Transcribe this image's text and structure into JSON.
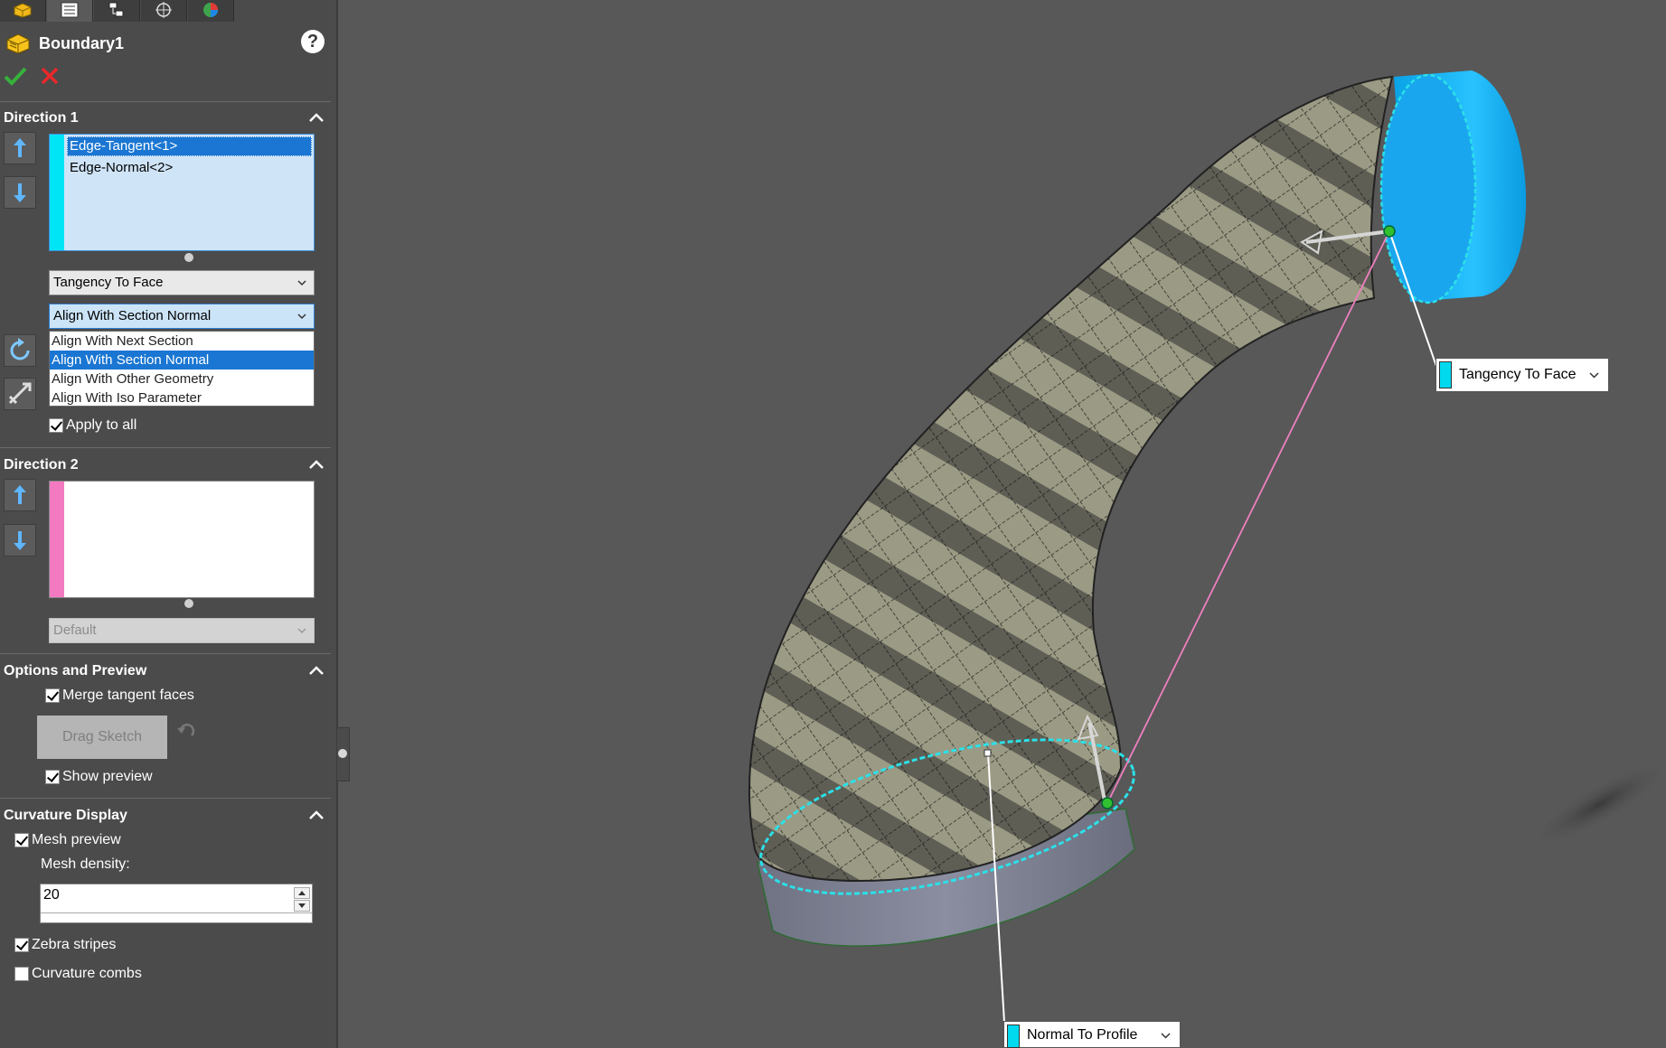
{
  "tabs": [
    {
      "name": "feature-manager",
      "active": false
    },
    {
      "name": "property-manager",
      "active": true
    },
    {
      "name": "configuration-manager",
      "active": false
    },
    {
      "name": "dimxpert-manager",
      "active": false
    },
    {
      "name": "display-manager",
      "active": false
    }
  ],
  "feature": {
    "title": "Boundary1",
    "help": "?"
  },
  "direction1": {
    "header": "Direction 1",
    "items": [
      "Edge-Tangent<1>",
      "Edge-Normal<2>"
    ],
    "selected_index": 0,
    "strip_color": "#00e5f5",
    "tangent_type": "Tangency To Face",
    "alignment": "Align With Section Normal",
    "alignment_options": [
      "Align With Next Section",
      "Align With Section Normal",
      "Align With Other Geometry",
      "Align With Iso Parameter"
    ],
    "alignment_selected_index": 1,
    "apply_to_all": "Apply to all"
  },
  "direction2": {
    "header": "Direction 2",
    "strip_color": "#f37ac0",
    "tangent_type": "Default"
  },
  "options": {
    "header": "Options and Preview",
    "merge_tangent": "Merge tangent faces",
    "drag_sketch": "Drag Sketch",
    "show_preview": "Show preview"
  },
  "curvature": {
    "header": "Curvature Display",
    "mesh_preview": "Mesh preview",
    "mesh_density_label": "Mesh density:",
    "mesh_density": "20",
    "zebra_stripes": "Zebra stripes",
    "curvature_combs": "Curvature combs"
  },
  "viewport": {
    "callout_top": "Tangency To Face",
    "callout_bottom": "Normal To Profile",
    "callout_strip_color": "#00d9ee",
    "surface_color": "#8b8a75",
    "cylinder_color": "#13b4f3",
    "profile_color": "#2ce0e8"
  }
}
